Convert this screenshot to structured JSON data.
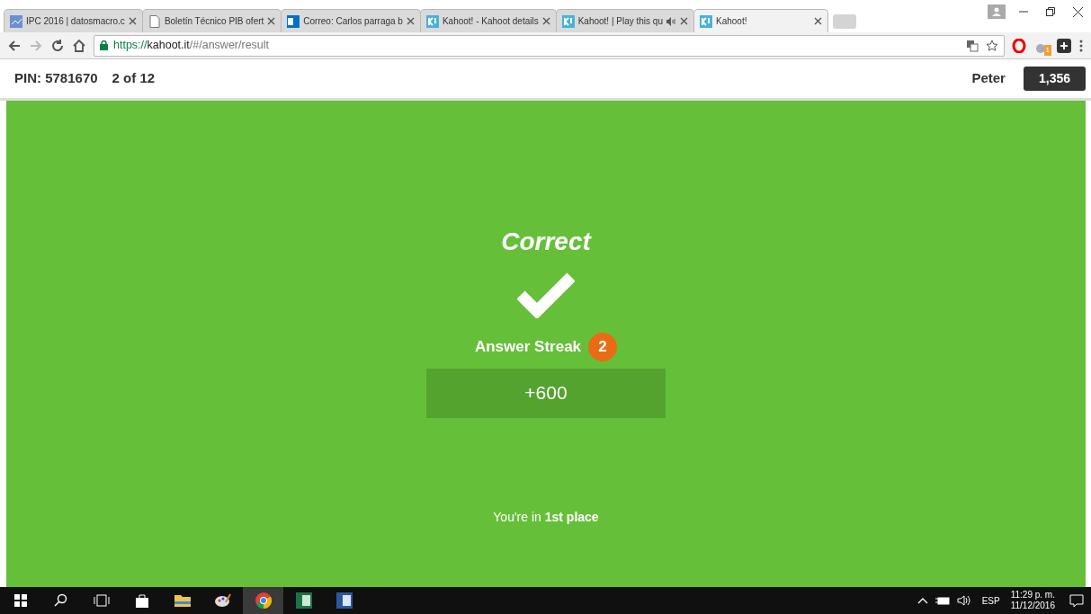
{
  "browser": {
    "tabs": [
      {
        "title": "IPC 2016 | datosmacro.c",
        "kind": "chart",
        "selected": false,
        "audio": false
      },
      {
        "title": "Boletín Técnico PIB ofert",
        "kind": "document",
        "selected": false,
        "audio": false
      },
      {
        "title": "Correo: Carlos parraga b",
        "kind": "mail",
        "selected": false,
        "audio": false
      },
      {
        "title": "Kahoot! - Kahoot details",
        "kind": "kahoot",
        "selected": false,
        "audio": false
      },
      {
        "title": "Kahoot! | Play this qu",
        "kind": "kahoot",
        "selected": false,
        "audio": true
      },
      {
        "title": "Kahoot!",
        "kind": "kahoot",
        "selected": true,
        "audio": false
      }
    ],
    "address": {
      "scheme": "https://",
      "host": "kahoot.it",
      "path": "/#/answer/result"
    },
    "extension_badge": "1"
  },
  "game": {
    "pin": "PIN: 5781670",
    "progress": "2 of 12",
    "player": "Peter",
    "score": "1,356"
  },
  "result": {
    "title": "Correct",
    "correct": true,
    "streak_label": "Answer Streak",
    "streak": "2",
    "points": "+600",
    "place": "You're in **1st place**"
  },
  "taskbar": {
    "language": "ESP",
    "time": "11:29 p. m.",
    "date": "11/12/2016"
  }
}
